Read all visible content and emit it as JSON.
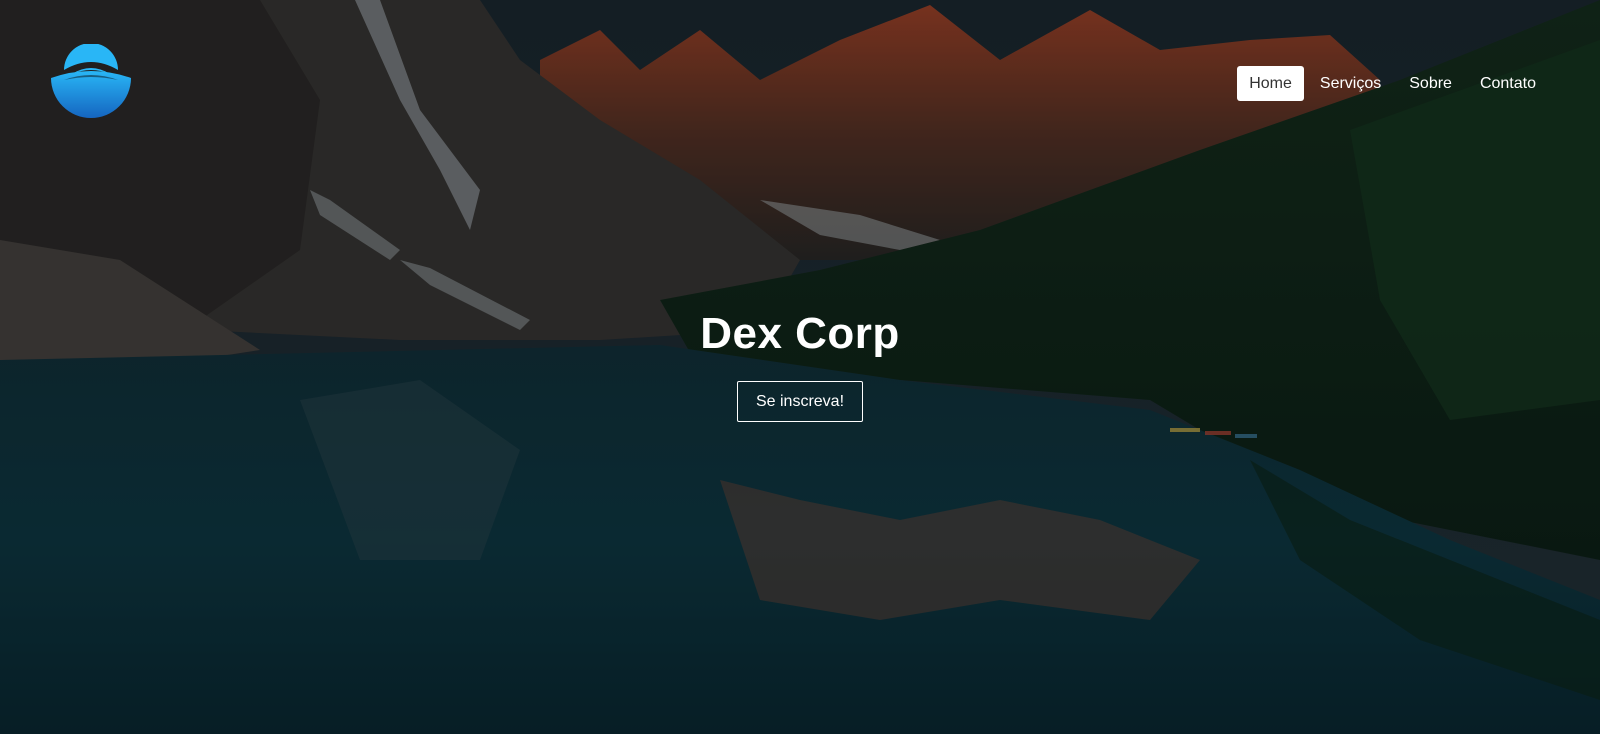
{
  "brand": {
    "logo_icon": "crescent-wave-logo-icon",
    "colors": {
      "logo_light": "#29b6f6",
      "logo_dark": "#1565c0"
    }
  },
  "nav": {
    "items": [
      {
        "label": "Home",
        "active": true
      },
      {
        "label": "Serviços",
        "active": false
      },
      {
        "label": "Sobre",
        "active": false
      },
      {
        "label": "Contato",
        "active": false
      }
    ]
  },
  "hero": {
    "title": "Dex Corp",
    "cta_label": "Se inscreva!",
    "background": "mountain-lake-photo"
  }
}
